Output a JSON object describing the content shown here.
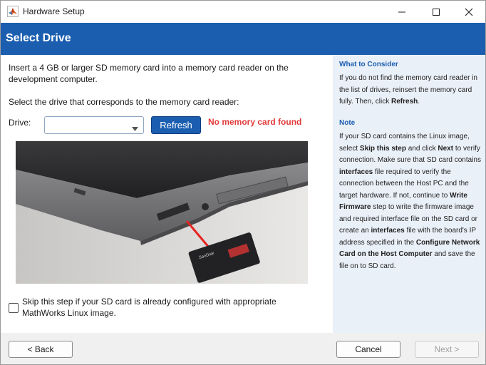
{
  "window": {
    "title": "Hardware Setup",
    "icon": "matlab-logo-icon"
  },
  "header": {
    "title": "Select Drive"
  },
  "main": {
    "instruction": "Insert a 4 GB or larger SD memory card into a memory card reader on the development computer.",
    "select_prompt": "Select the drive that corresponds to the memory card reader:",
    "drive_label": "Drive:",
    "drive_value": "",
    "refresh_label": "Refresh",
    "error_text": "No memory card found",
    "skip_label": "Skip this step if your SD card is already configured with appropriate MathWorks Linux image.",
    "skip_checked": false
  },
  "info": {
    "consider_title": "What to Consider",
    "consider_text_1": "If you do not find the memory card reader in the list of drives, reinsert the memory card fully. Then, click ",
    "consider_bold_1": "Refresh",
    "consider_text_2": ".",
    "note_title": "Note",
    "note": {
      "t1": "If your SD card contains the Linux image, select ",
      "b1": "Skip this step",
      "t2": " and click ",
      "b2": "Next",
      "t3": " to verify connection. Make sure that SD card contains ",
      "b3": "interfaces",
      "t4": " file required to verify the connection between the Host PC and the target hardware. If not, continue to ",
      "b4": "Write Firmware",
      "t5": " step to write the firmware image and required interface file on the SD card or create an ",
      "b5": "interfaces",
      "t6": " file with the board's IP address specified in the ",
      "b6": "Configure Network Card on the Host Computer",
      "t7": " and save the file on to SD card."
    }
  },
  "footer": {
    "back_label": "< Back",
    "cancel_label": "Cancel",
    "next_label": "Next >"
  },
  "colors": {
    "header_blue": "#1b5eb0",
    "error_red": "#e23b3b",
    "info_bg": "#eaf0f8"
  }
}
